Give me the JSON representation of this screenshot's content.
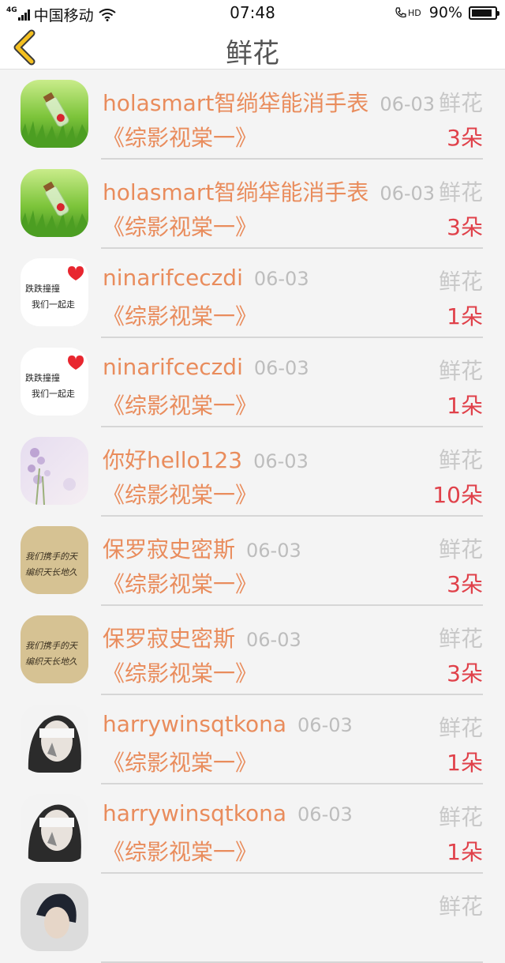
{
  "status_bar": {
    "network": "4G",
    "carrier": "中国移动",
    "time": "07:48",
    "hd_label": "HD",
    "battery_pct": "90%",
    "battery_level": 0.9
  },
  "nav": {
    "title": "鲜花",
    "back_icon": "chevron-left-icon"
  },
  "list": [
    {
      "name": "holasmart智绱牮能消手表",
      "date": "06-03",
      "movie": "《综影视棠一》",
      "gift": "鲜花",
      "count": "3朵",
      "avatar": "bottle-grass"
    },
    {
      "name": "holasmart智绱牮能消手表",
      "date": "06-03",
      "movie": "《综影视棠一》",
      "gift": "鲜花",
      "count": "3朵",
      "avatar": "bottle-grass"
    },
    {
      "name": "ninarifceczdi",
      "date": "06-03",
      "movie": "《综影视棠一》",
      "gift": "鲜花",
      "count": "1朵",
      "avatar": "text-heart"
    },
    {
      "name": "ninarifceczdi",
      "date": "06-03",
      "movie": "《综影视棠一》",
      "gift": "鲜花",
      "count": "1朵",
      "avatar": "text-heart"
    },
    {
      "name": "你好hello123",
      "date": "06-03",
      "movie": "《综影视棠一》",
      "gift": "鲜花",
      "count": "10朵",
      "avatar": "lavender"
    },
    {
      "name": "保罗寂史密斯",
      "date": "06-03",
      "movie": "《综影视棠一》",
      "gift": "鲜花",
      "count": "3朵",
      "avatar": "handwriting"
    },
    {
      "name": "保罗寂史密斯",
      "date": "06-03",
      "movie": "《综影视棠一》",
      "gift": "鲜花",
      "count": "3朵",
      "avatar": "handwriting"
    },
    {
      "name": "harrywinsqtkona",
      "date": "06-03",
      "movie": "《综影视棠一》",
      "gift": "鲜花",
      "count": "1朵",
      "avatar": "girl-bw"
    },
    {
      "name": "harrywinsqtkona",
      "date": "06-03",
      "movie": "《综影视棠一》",
      "gift": "鲜花",
      "count": "1朵",
      "avatar": "girl-bw"
    },
    {
      "name": "",
      "date": "",
      "movie": "",
      "gift": "鲜花",
      "count": "",
      "avatar": "girl-dark"
    }
  ],
  "avatar_text": {
    "text-heart": [
      "跌跌撞撞",
      "我们一起走"
    ],
    "handwriting": [
      "我们携手的天",
      "编织天长地久"
    ]
  }
}
